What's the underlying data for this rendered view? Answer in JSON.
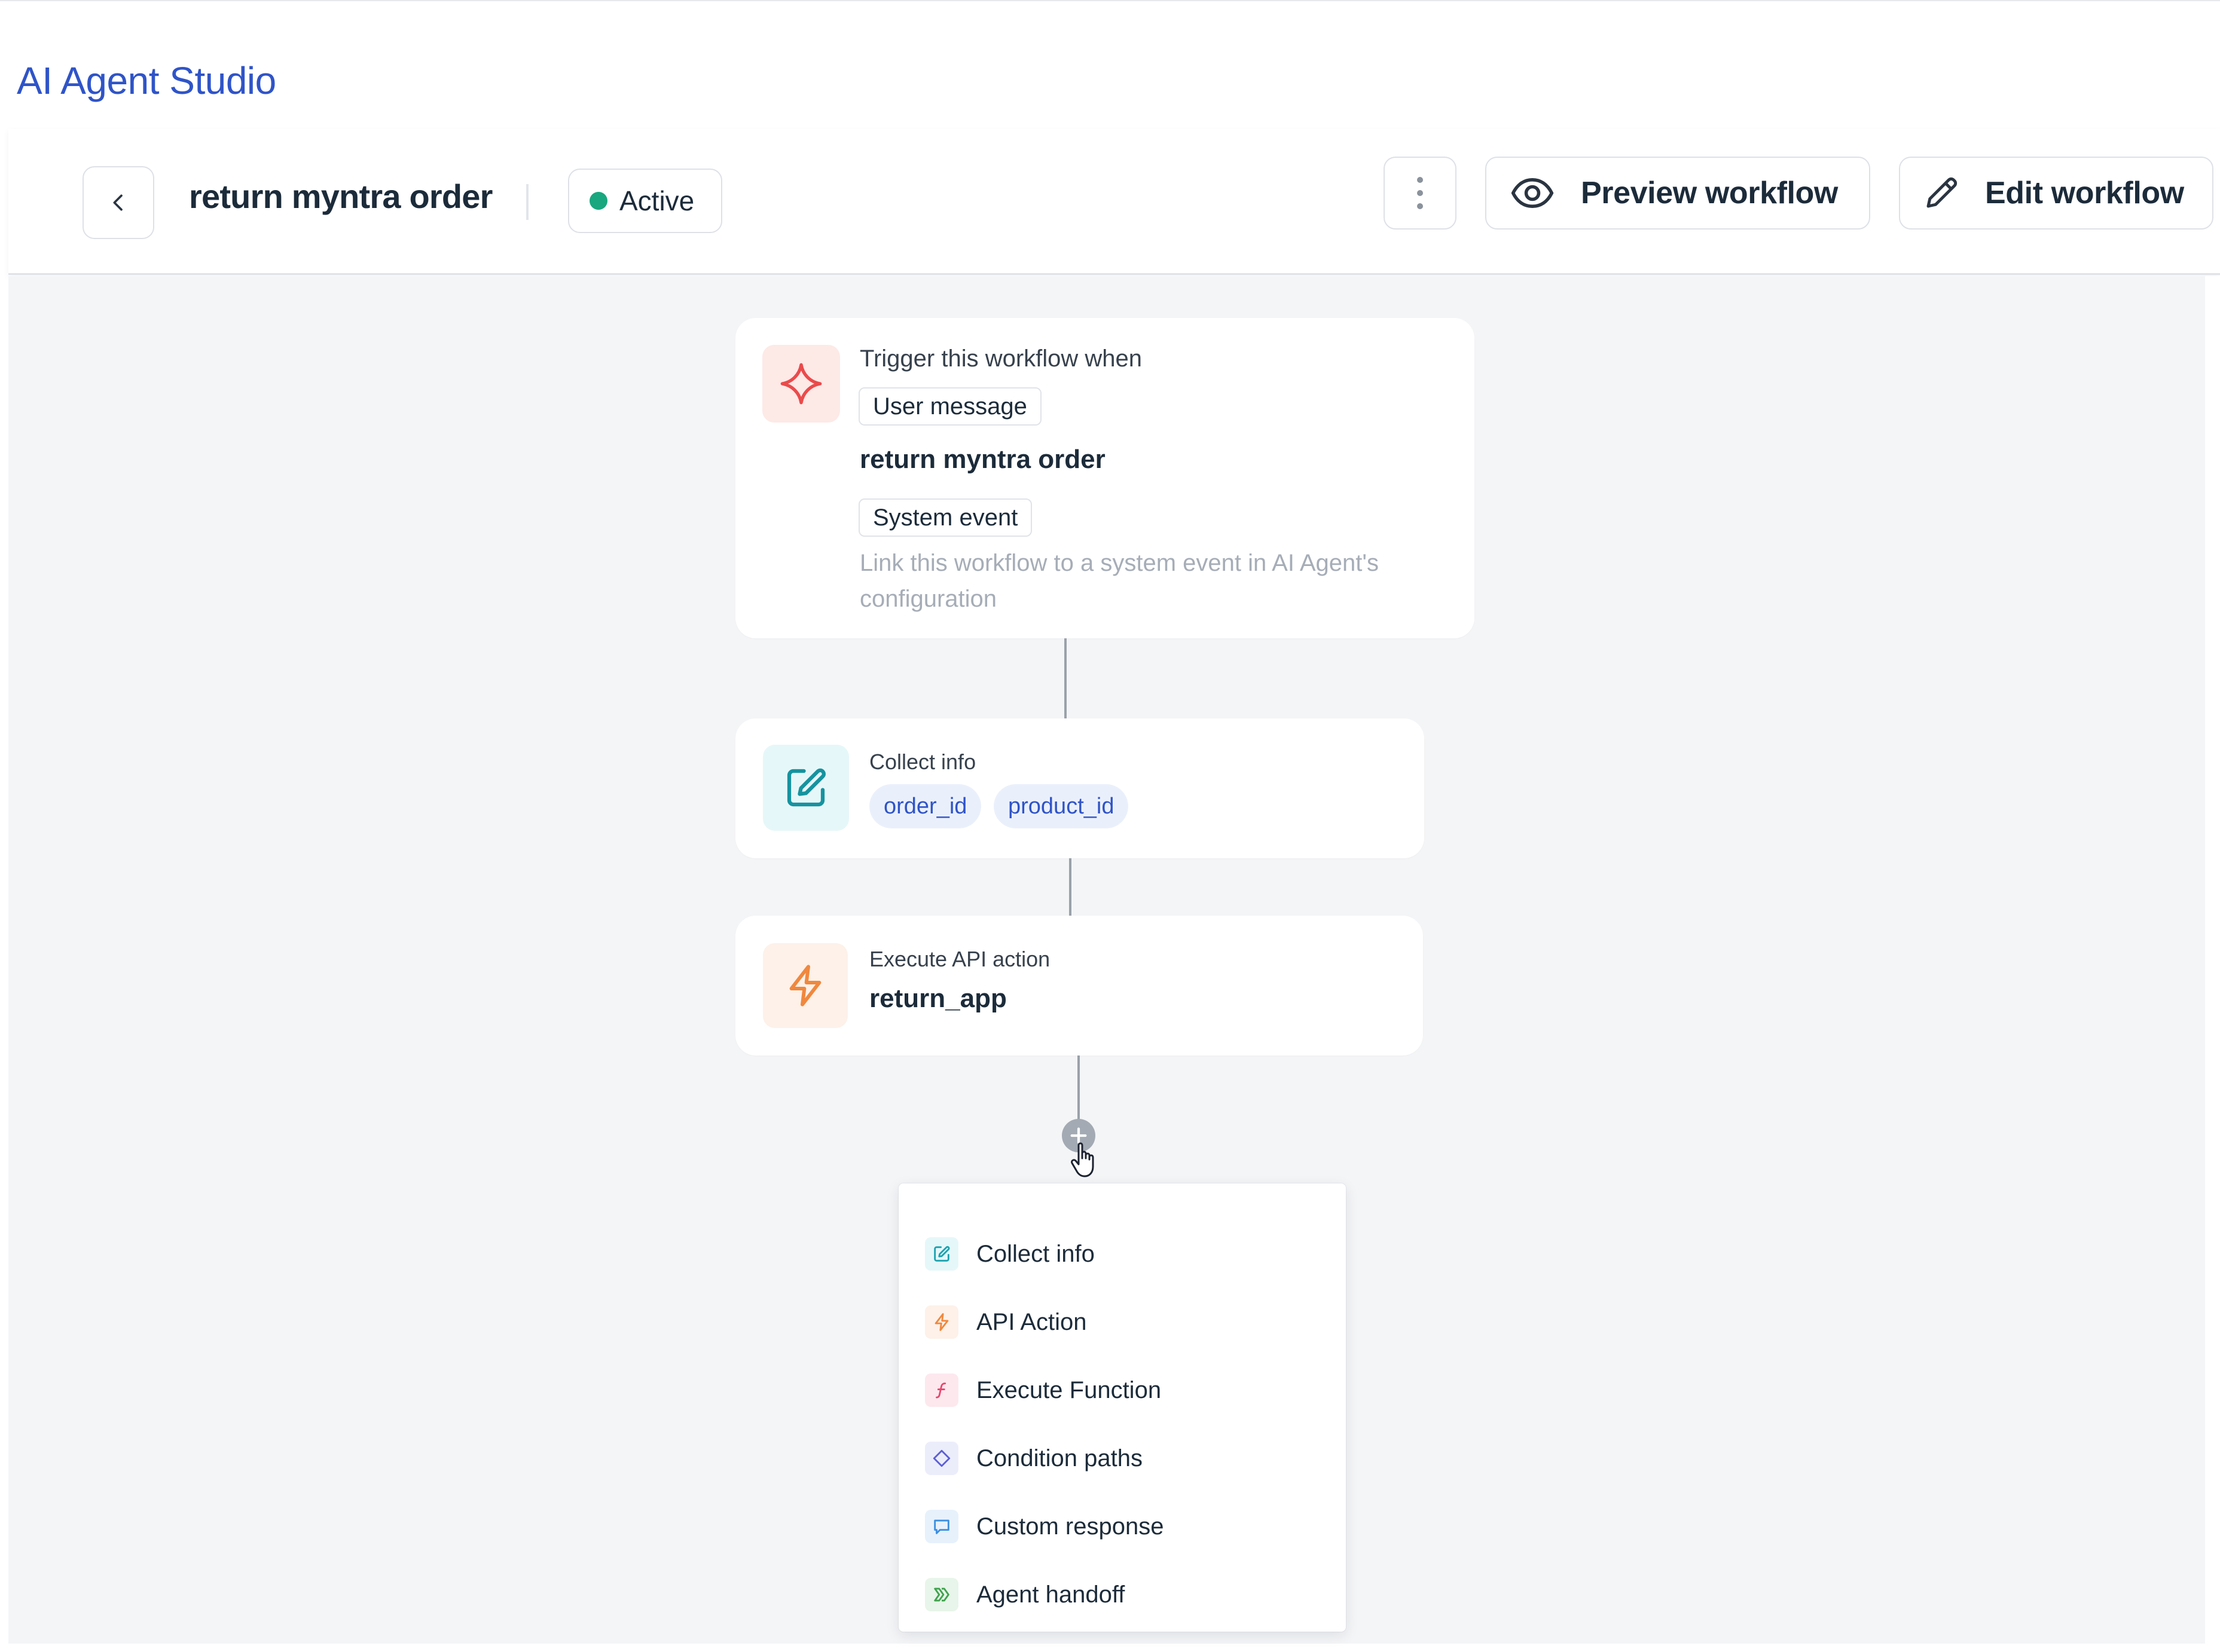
{
  "app": {
    "brand": "AI Agent Studio"
  },
  "workflow": {
    "title": "return myntra order",
    "status": "Active",
    "colors": {
      "accent": "#2f54c8",
      "status_active": "#18a77f"
    }
  },
  "header": {
    "back_icon": "chevron-left-icon",
    "more_icon": "vertical-dots-icon",
    "preview_label": "Preview workflow",
    "preview_icon": "eye-icon",
    "edit_label": "Edit workflow",
    "edit_icon": "pencil-icon"
  },
  "trigger": {
    "icon": "sparkle-icon",
    "heading": "Trigger this workflow when",
    "user_message_tag": "User message",
    "phrase": "return myntra order",
    "system_event_tag": "System event",
    "note": "Link this workflow to a system event in AI Agent's configuration"
  },
  "steps": {
    "collect": {
      "icon": "edit-square-icon",
      "heading": "Collect info",
      "fields": [
        "order_id",
        "product_id"
      ]
    },
    "api": {
      "icon": "lightning-icon",
      "heading": "Execute API action",
      "name": "return_app"
    }
  },
  "add_step": {
    "icon": "plus-icon"
  },
  "menu": {
    "items": [
      {
        "label": "Collect info",
        "icon": "edit-square-icon",
        "color": "#1ba3b0",
        "bg": "#e6f7f9"
      },
      {
        "label": "API Action",
        "icon": "lightning-icon",
        "color": "#f0883e",
        "bg": "#fdf1e9"
      },
      {
        "label": "Execute Function",
        "icon": "function-icon",
        "color": "#e5486e",
        "bg": "#fde8ee"
      },
      {
        "label": "Condition paths",
        "icon": "diamond-icon",
        "color": "#5b5fd6",
        "bg": "#ecedfb"
      },
      {
        "label": "Custom response",
        "icon": "chat-bubble-icon",
        "color": "#3b8fe0",
        "bg": "#e7f1fc"
      },
      {
        "label": "Agent handoff",
        "icon": "handoff-arrows-icon",
        "color": "#3fa34d",
        "bg": "#e8f5ea"
      }
    ]
  }
}
